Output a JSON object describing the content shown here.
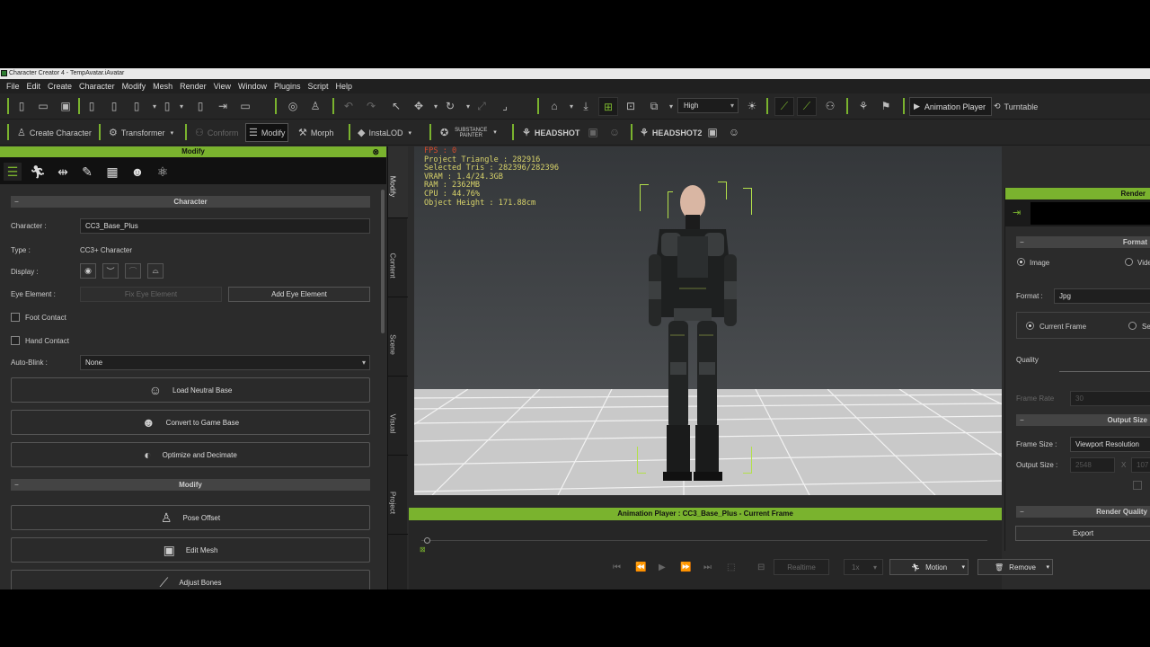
{
  "window": {
    "title": "Character Creator 4 - TempAvatar.iAvatar"
  },
  "menu": [
    "File",
    "Edit",
    "Create",
    "Character",
    "Modify",
    "Mesh",
    "Render",
    "View",
    "Window",
    "Plugins",
    "Script",
    "Help"
  ],
  "toolbar": {
    "quality": "High",
    "animation_player": "Animation Player",
    "turntable": "Turntable"
  },
  "toolbar2": {
    "create_character": "Create Character",
    "transformer": "Transformer",
    "conform": "Conform",
    "modify": "Modify",
    "morph": "Morph",
    "instalod": "InstaLOD",
    "substance": "SUBSTANCE PAINTER",
    "headshot": "HEADSHOT",
    "headshot2": "HEADSHOT2"
  },
  "modify_panel": {
    "title": "Modify",
    "section_character": "Character",
    "character_label": "Character :",
    "character_value": "CC3_Base_Plus",
    "type_label": "Type :",
    "type_value": "CC3+ Character",
    "display_label": "Display :",
    "eye_label": "Eye Element :",
    "fix_eye": "Fix Eye Element",
    "add_eye": "Add Eye Element",
    "foot_contact": "Foot Contact",
    "hand_contact": "Hand Contact",
    "autoblink_label": "Auto-Blink :",
    "autoblink_value": "None",
    "load_neutral": "Load Neutral Base",
    "convert_game": "Convert to Game Base",
    "optimize": "Optimize and Decimate",
    "section_modify": "Modify",
    "pose_offset": "Pose Offset",
    "edit_mesh": "Edit Mesh",
    "adjust_bones": "Adjust Bones"
  },
  "side_tabs": [
    "Modify",
    "Content",
    "Scene",
    "Visual",
    "Project"
  ],
  "viewport_stats": {
    "fps": "FPS : 0",
    "triangles": "Project Triangle : 282916",
    "selected": "Selected Tris : 282396/282396",
    "vram": "VRAM : 1.4/24.3GB",
    "ram": "RAM : 2362MB",
    "cpu": "CPU : 44.76%",
    "height": "Object Height : 171.88cm"
  },
  "animation_player": {
    "title": "Animation Player : CC3_Base_Plus - Current Frame",
    "realtime": "Realtime",
    "speed": "1x",
    "motion": "Motion",
    "remove": "Remove"
  },
  "render_panel": {
    "title": "Render",
    "format_section": "Format",
    "image": "Image",
    "video": "Vide",
    "format_label": "Format :",
    "format_value": "Jpg",
    "current_frame": "Current Frame",
    "se": "Se",
    "quality": "Quality",
    "frame_rate_label": "Frame Rate",
    "frame_rate": "30",
    "output_section": "Output Size",
    "frame_size_label": "Frame Size :",
    "frame_size_value": "Viewport Resolution",
    "output_size_label": "Output Size :",
    "width": "2548",
    "x": "X",
    "height": "107",
    "render_quality": "Render Quality",
    "export": "Export"
  },
  "colors": {
    "accent": "#7ab32e",
    "stats_text": "#d8d36a",
    "fps_text": "#d84a2a"
  }
}
